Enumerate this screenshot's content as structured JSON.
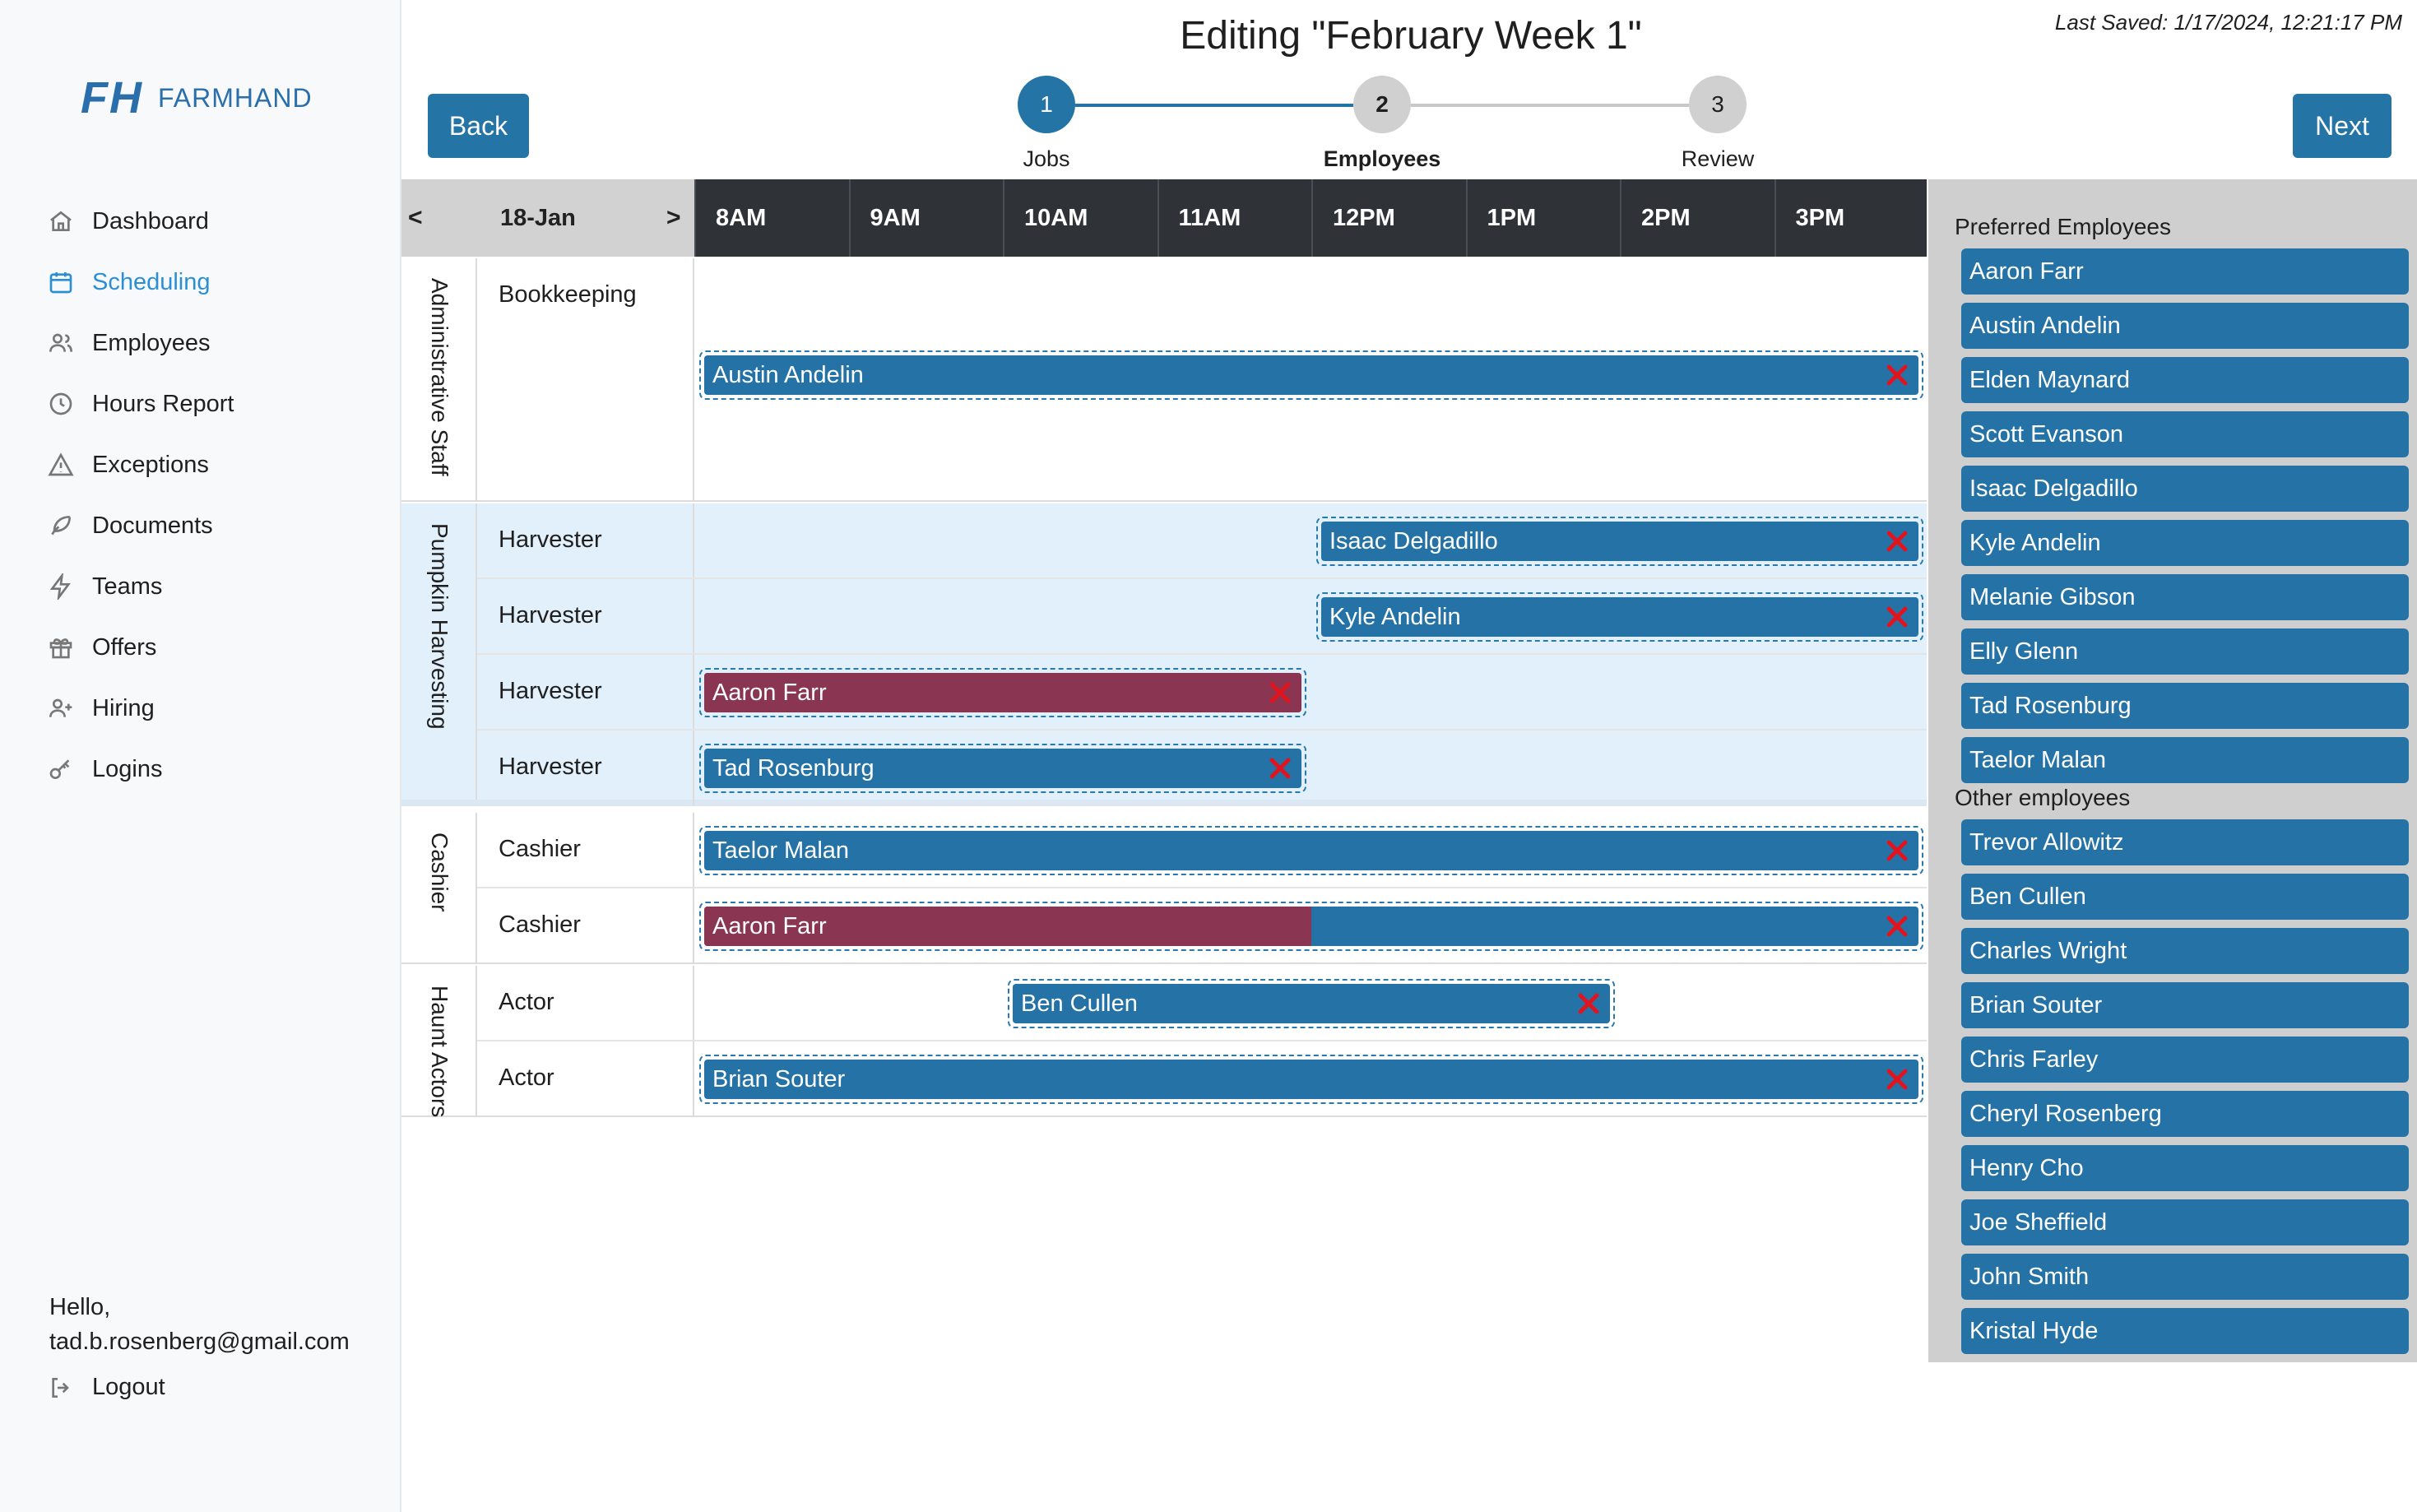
{
  "app": {
    "logo_mark": "FH",
    "logo_text": "FARMHAND"
  },
  "nav": [
    {
      "label": "Dashboard",
      "icon": "home-icon"
    },
    {
      "label": "Scheduling",
      "icon": "calendar-icon",
      "active": true
    },
    {
      "label": "Employees",
      "icon": "users-icon"
    },
    {
      "label": "Hours Report",
      "icon": "clock-icon"
    },
    {
      "label": "Exceptions",
      "icon": "warning-icon"
    },
    {
      "label": "Documents",
      "icon": "feather-icon"
    },
    {
      "label": "Teams",
      "icon": "lightning-icon"
    },
    {
      "label": "Offers",
      "icon": "gift-icon"
    },
    {
      "label": "Hiring",
      "icon": "user-plus-icon"
    },
    {
      "label": "Logins",
      "icon": "key-icon"
    }
  ],
  "user": {
    "greeting": "Hello,",
    "email": "tad.b.rosenberg@gmail.com",
    "logout_label": "Logout"
  },
  "header": {
    "title": "Editing \"February Week 1\"",
    "last_saved": "Last Saved: 1/17/2024, 12:21:17 PM",
    "back_label": "Back",
    "next_label": "Next"
  },
  "steps": [
    {
      "number": "1",
      "label": "Jobs",
      "state": "done"
    },
    {
      "number": "2",
      "label": "Employees",
      "state": "current"
    },
    {
      "number": "3",
      "label": "Review",
      "state": "todo"
    }
  ],
  "grid": {
    "date": "18-Jan",
    "prev_label": "<",
    "next_label": ">",
    "hours": [
      "8AM",
      "9AM",
      "10AM",
      "11AM",
      "12PM",
      "1PM",
      "2PM",
      "3PM"
    ],
    "sections": [
      {
        "name": "Administrative Staff",
        "shaded": false,
        "rows": [
          {
            "job": "Bookkeeping",
            "height": 2,
            "shift": {
              "employee": "Austin Andelin",
              "start": 8,
              "end": 16
            }
          }
        ]
      },
      {
        "name": "Pumpkin Harvesting",
        "shaded": true,
        "rows": [
          {
            "job": "Harvester",
            "shift": {
              "employee": "Isaac Delgadillo",
              "start": 12,
              "end": 16
            }
          },
          {
            "job": "Harvester",
            "shift": {
              "employee": "Kyle Andelin",
              "start": 12,
              "end": 16
            }
          },
          {
            "job": "Harvester",
            "shift": {
              "employee": "Aaron Farr",
              "start": 8,
              "end": 12,
              "conflict_fraction": 1.0
            }
          },
          {
            "job": "Harvester",
            "shift": {
              "employee": "Tad Rosenburg",
              "start": 8,
              "end": 12
            }
          }
        ]
      },
      {
        "name": "Cashier",
        "shaded": false,
        "rows": [
          {
            "job": "Cashier",
            "shift": {
              "employee": "Taelor Malan",
              "start": 8,
              "end": 16
            }
          },
          {
            "job": "Cashier",
            "shift": {
              "employee": "Aaron Farr",
              "start": 8,
              "end": 16,
              "conflict_fraction": 0.5
            }
          }
        ]
      },
      {
        "name": "Haunt Actors",
        "shaded": false,
        "rows": [
          {
            "job": "Actor",
            "shift": {
              "employee": "Ben Cullen",
              "start": 10,
              "end": 14
            }
          },
          {
            "job": "Actor",
            "shift": {
              "employee": "Brian Souter",
              "start": 8,
              "end": 16
            }
          }
        ]
      }
    ]
  },
  "employees": {
    "preferred_heading": "Preferred Employees",
    "preferred": [
      "Aaron Farr",
      "Austin Andelin",
      "Elden Maynard",
      "Scott Evanson",
      "Isaac Delgadillo",
      "Kyle Andelin",
      "Melanie Gibson",
      "Elly Glenn",
      "Tad Rosenburg",
      "Taelor Malan"
    ],
    "other_heading": "Other employees",
    "other": [
      "Trevor Allowitz",
      "Ben Cullen",
      "Charles Wright",
      "Brian Souter",
      "Chris Farley",
      "Cheryl Rosenberg",
      "Henry Cho",
      "Joe Sheffield",
      "John Smith",
      "Kristal Hyde"
    ]
  },
  "colors": {
    "accent": "#2474a6",
    "conflict": "#8a3551",
    "remove_x": "#e0141e",
    "shaded_section": "#e2f0fb"
  }
}
